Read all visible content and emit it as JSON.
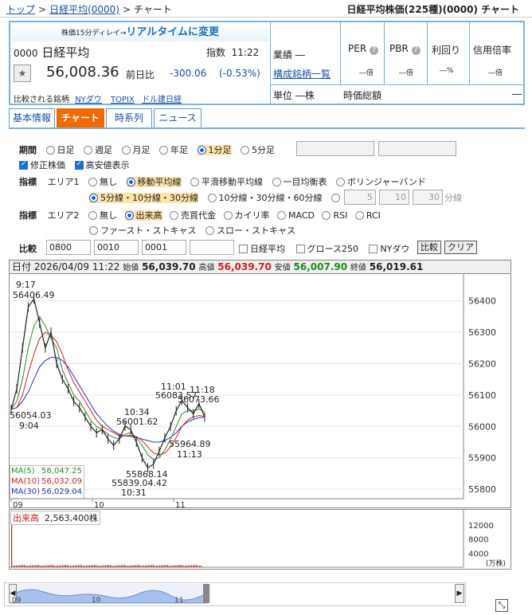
{
  "breadcrumb": [
    "トップ",
    "日経平均(0000)",
    "チャート"
  ],
  "page_title": "日経平均株価(225種)(0000) チャート",
  "banner": {
    "small": "株価15分ディレイ→",
    "link": "リアルタイムに変更"
  },
  "quote": {
    "code": "0000",
    "name": "日経平均",
    "kind": "指数",
    "time": "11:22",
    "price": "56,008.36",
    "change_label": "前日比",
    "change": "-300.06",
    "change_pct": "(-0.53%)",
    "compare_label": "比較される銘柄",
    "compare": [
      "NYダウ",
      "TOPIX",
      "ドル建日経"
    ],
    "sector_label": "業績",
    "sector_val": "―",
    "constituents": "構成銘柄一覧",
    "unit_label": "単位",
    "unit_val": "―株",
    "per": "PER",
    "pbr": "PBR",
    "yield": "利回り",
    "margin": "信用倍率",
    "per_val": "―倍",
    "pbr_val": "―倍",
    "yield_val": "―%",
    "margin_val": "―倍",
    "mcap_label": "時価総額",
    "mcap_val": "―"
  },
  "tabs": [
    "基本情報",
    "チャート",
    "時系列",
    "ニュース"
  ],
  "period": {
    "label": "期間",
    "options": [
      "日足",
      "週足",
      "月足",
      "年足",
      "1分足",
      "5分足"
    ],
    "selected": "1分足"
  },
  "checks": [
    "修正株価",
    "高安値表示"
  ],
  "ind1": {
    "label": "指標",
    "area": "エリア1",
    "options": [
      "無し",
      "移動平均線",
      "平滑移動平均線",
      "一目均衡表",
      "ボリンジャーバンド"
    ],
    "selected": "移動平均線",
    "ma_opts": [
      "5分線・10分線・30分線",
      "10分線・30分線・60分線"
    ],
    "custom": [
      "5",
      "10",
      "30"
    ],
    "unit": "分線"
  },
  "ind2": {
    "label": "指標",
    "area": "エリア2",
    "options": [
      "無し",
      "出来高",
      "売買代金",
      "カイリ率",
      "MACD",
      "RSI",
      "RCI",
      "ファースト・ストキャス",
      "スロー・ストキャス"
    ],
    "selected": "出来高"
  },
  "compare": {
    "label": "比較",
    "inputs": [
      "0800",
      "0010",
      "0001",
      ""
    ],
    "checks": [
      "日経平均",
      "グロース250",
      "NYダウ"
    ],
    "btn": "比較",
    "clear": "クリア"
  },
  "ohlc": {
    "date_label": "日付",
    "date": "2026/04/09 11:22",
    "open_label": "始値",
    "open": "56,039.70",
    "high_label": "高値",
    "high": "56,039.70",
    "low_label": "安値",
    "low": "56,007.90",
    "close_label": "終値",
    "close": "56,019.61"
  },
  "annotations": {
    "hi_time": "9:17",
    "hi_val": "56406.49",
    "start_val": "56054.03",
    "start_time": "9:04",
    "a1_time": "11:01",
    "a1_val": "56083.57",
    "a2_time": "11:18",
    "a2_val": "56073.66",
    "a3_time": "10:34",
    "a3_val": "56001.62",
    "a4_val": "55964.89",
    "a4_time": "11:13",
    "a5_val": "55868.14",
    "a6_val": "55839.0",
    "a6b": "4.42",
    "a6_time": "10:31"
  },
  "ma_legend": [
    {
      "name": "MA(5)",
      "val": "56,047.25",
      "color": "#2a8a2a"
    },
    {
      "name": "MA(10)",
      "val": "56,032.09",
      "color": "#d02020"
    },
    {
      "name": "MA(30)",
      "val": "56,029.04",
      "color": "#2030c0"
    }
  ],
  "volume_label": "出来高",
  "volume_val": "2,563,400株",
  "vol_unit": "(万株)",
  "chart_data": {
    "type": "line",
    "ylim": [
      55780,
      56460
    ],
    "yticks": [
      "56400",
      "56300",
      "56200",
      "56100",
      "56000",
      "55900",
      "55800"
    ],
    "xticks": [
      "09",
      "10",
      "11"
    ],
    "price": [
      56054,
      56120,
      56250,
      56380,
      56406,
      56330,
      56250,
      56300,
      56200,
      56150,
      56120,
      56080,
      56060,
      56030,
      56000,
      55980,
      55990,
      55960,
      55940,
      55960,
      56001,
      55990,
      55950,
      55900,
      55868,
      55880,
      55920,
      55964,
      56000,
      56050,
      56083,
      56060,
      56040,
      56073,
      56030
    ],
    "ma5": [
      56054,
      56080,
      56150,
      56250,
      56320,
      56350,
      56320,
      56280,
      56250,
      56180,
      56140,
      56100,
      56080,
      56050,
      56020,
      56000,
      55990,
      55975,
      55965,
      55960,
      55975,
      55980,
      55965,
      55940,
      55910,
      55895,
      55900,
      55925,
      55960,
      56000,
      56040,
      56050,
      56050,
      56055,
      56047
    ],
    "ma10": [
      56054,
      56060,
      56100,
      56170,
      56230,
      56280,
      56300,
      56290,
      56270,
      56230,
      56180,
      56140,
      56110,
      56080,
      56050,
      56020,
      56000,
      55990,
      55980,
      55970,
      55970,
      55972,
      55968,
      55955,
      55935,
      55915,
      55910,
      55915,
      55935,
      55965,
      56000,
      56020,
      56030,
      56035,
      56032
    ],
    "ma30": [
      56054,
      56060,
      56080,
      56110,
      56150,
      56190,
      56210,
      56220,
      56220,
      56210,
      56190,
      56160,
      56130,
      56100,
      56070,
      56040,
      56020,
      56000,
      55985,
      55975,
      55970,
      55968,
      55965,
      55960,
      55955,
      55950,
      55950,
      55955,
      55965,
      55980,
      56000,
      56015,
      56022,
      56028,
      56029
    ],
    "vol_yticks": [
      "12000",
      "8000",
      "4000"
    ]
  }
}
